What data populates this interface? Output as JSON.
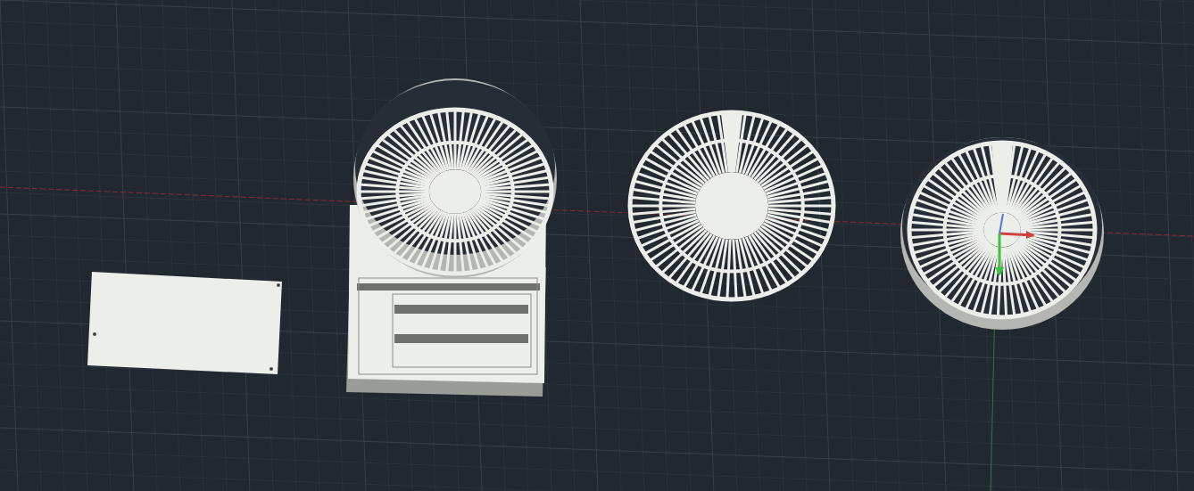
{
  "viewport": {
    "objects": [
      {
        "kind": "plate"
      },
      {
        "kind": "fan-housing"
      },
      {
        "kind": "fan-grille"
      },
      {
        "kind": "fan-ring"
      }
    ],
    "ucs_icon": true
  }
}
